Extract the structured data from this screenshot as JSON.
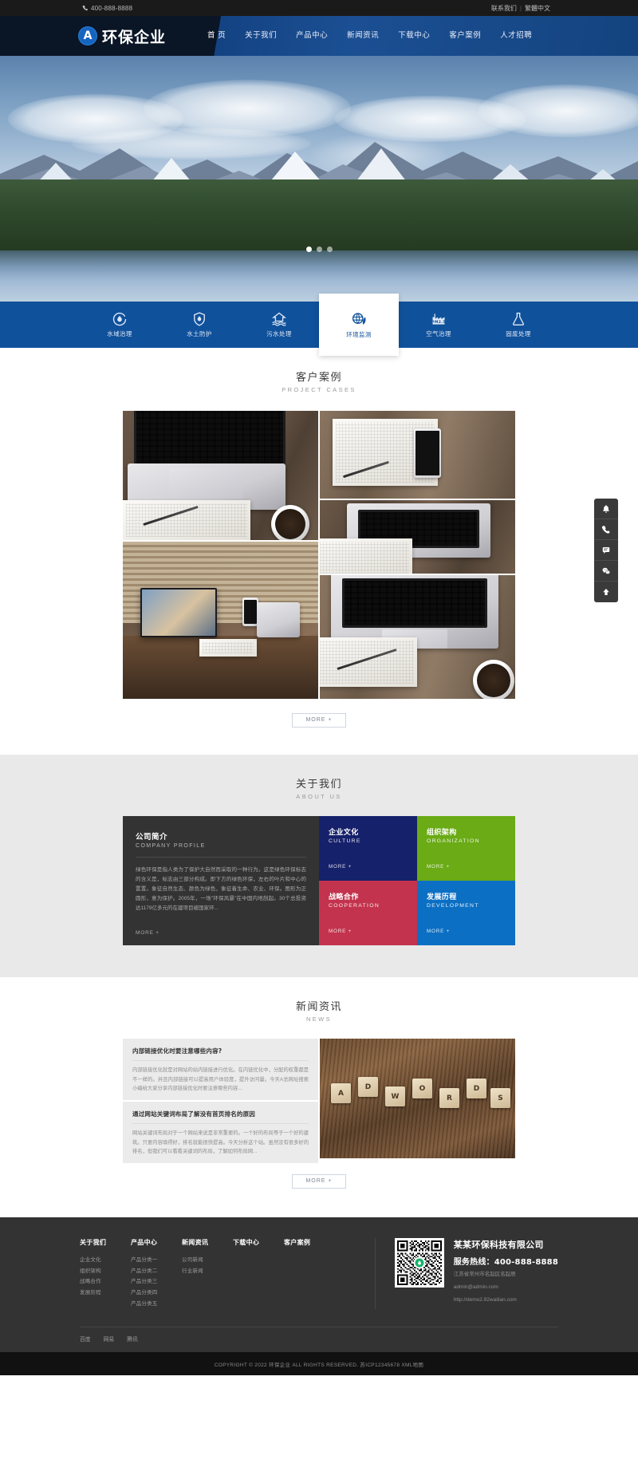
{
  "topbar": {
    "phone": "400-888-8888",
    "phone_icon": "phone-icon",
    "contact": "联系我们",
    "separator": "|",
    "language": "繁體中文"
  },
  "header": {
    "logo_mark": "A",
    "logo_text": "环保企业",
    "nav": [
      {
        "label": "首 页",
        "active": true
      },
      {
        "label": "关于我们",
        "active": false
      },
      {
        "label": "产品中心",
        "active": false
      },
      {
        "label": "新闻资讯",
        "active": false
      },
      {
        "label": "下载中心",
        "active": false
      },
      {
        "label": "客户案例",
        "active": false
      },
      {
        "label": "人才招聘",
        "active": false
      }
    ]
  },
  "services": [
    {
      "label": "水域治理",
      "icon": "water-drop-circle-icon",
      "active": false
    },
    {
      "label": "水土防护",
      "icon": "shield-drop-icon",
      "active": false
    },
    {
      "label": "污水处理",
      "icon": "house-water-icon",
      "active": false
    },
    {
      "label": "环境监测",
      "icon": "globe-leaf-icon",
      "active": true
    },
    {
      "label": "空气治理",
      "icon": "pm25-factory-icon",
      "active": false
    },
    {
      "label": "固废处理",
      "icon": "flask-icon",
      "active": false
    }
  ],
  "cases": {
    "title_cn": "客户案例",
    "title_en": "PROJECT CASES",
    "more": "MORE +",
    "items": [
      {
        "name": "laptop-notebook-pen-coffee"
      },
      {
        "name": "phone-notebook-desk"
      },
      {
        "name": "laptop-paper-desk"
      },
      {
        "name": "home-office-desk-monitor"
      },
      {
        "name": "laptop-keyboard-coffee-wood"
      }
    ]
  },
  "about": {
    "title_cn": "关于我们",
    "title_en": "ABOUT US",
    "profile": {
      "title_cn": "公司简介",
      "title_en": "COMPANY PROFILE",
      "text": "绿色环保是指人类为了保护大自然而采取的一种行为。这是绿色环保标志的含义是，标志由三部分构成。即下方的绿色环保，左右的叶片和中心的置置。象征自然生态、颜色为绿色，象征着生命、农业、环保。图形为正圆形，意为保护。2005年，一场\"环保风暴\"在中国内地刮起。30个总投资达1179亿多元的在建项目被国家环...",
      "more": "MORE +"
    },
    "tiles": [
      {
        "title_cn": "企业文化",
        "title_en": "CULTURE",
        "more": "MORE +",
        "color": "#16216b"
      },
      {
        "title_cn": "组织架构",
        "title_en": "ORGANIZATION",
        "more": "MORE +",
        "color": "#6aab16"
      },
      {
        "title_cn": "战略合作",
        "title_en": "COOPERATION",
        "more": "MORE +",
        "color": "#c3334d"
      },
      {
        "title_cn": "发展历程",
        "title_en": "DEVELOPMENT",
        "more": "MORE +",
        "color": "#0b6fc4"
      }
    ]
  },
  "news": {
    "title_cn": "新闻资讯",
    "title_en": "NEWS",
    "more": "MORE +",
    "items": [
      {
        "title": "内部链接优化时要注意哪些内容?",
        "summary": "内部链接优化就是对网站的站内链接进行优化。在内链优化中，分配的权重都是不一样的。并且内部链接可以提高用户体验度，提升访问量。今天A总网址搜索小编给大家分享内部链接优化时要注意哪些内容..."
      },
      {
        "title": "通过网站关键词布局了解没有首页排名的原因",
        "summary": "网站关键词布局对于一个网站来说是非常重要的。一个好的布局等于一个好的建筑。只要内容填得好，排名就能很快提高。今天分析这个站。虽然没有很多好的排名，但我们可以看看关键词的布局，了解如何布局网..."
      }
    ],
    "image": {
      "name": "adwords-scrabble-tiles",
      "tiles": [
        "A",
        "D",
        "W",
        "O",
        "R",
        "D",
        "S"
      ]
    }
  },
  "footer": {
    "columns": [
      {
        "title": "关于我们",
        "links": [
          "企业文化",
          "组织架构",
          "战略合作",
          "发展历程"
        ]
      },
      {
        "title": "产品中心",
        "links": [
          "产品分类一",
          "产品分类二",
          "产品分类三",
          "产品分类四",
          "产品分类五"
        ]
      },
      {
        "title": "新闻资讯",
        "links": [
          "公司新闻",
          "行业新闻"
        ]
      },
      {
        "title": "下载中心",
        "links": []
      },
      {
        "title": "客户案例",
        "links": []
      }
    ],
    "qr_label": "qr-code",
    "company_name": "某某环保科技有限公司",
    "hotline": "服务热线：400-888-8888",
    "address": "江苏省常州市名起区名起居",
    "email": "admin@admin.com",
    "website": "http://demo2.92wailian.com",
    "friendly_links": [
      "百度",
      "网易",
      "腾讯"
    ],
    "copyright": "COPYRIGHT © 2022 环保企业 ALL RIGHTS RESERVED. 苏ICP12345678 XML地图"
  },
  "floatbar": [
    {
      "icon": "bell-icon",
      "glyph": "🔔"
    },
    {
      "icon": "phone-icon",
      "glyph": "✆"
    },
    {
      "icon": "qq-icon",
      "glyph": "💬"
    },
    {
      "icon": "wechat-icon",
      "glyph": "✉"
    },
    {
      "icon": "back-to-top-icon",
      "glyph": "⬆"
    }
  ],
  "banner": {
    "name": "mountain-lake-landscape",
    "dots": 3,
    "active_dot": 0
  },
  "colors": {
    "nav_blue": "#12407f",
    "service_blue": "#10519b",
    "dark": "#333333",
    "footer_dark": "#333333",
    "copyright_dark": "#111111"
  }
}
